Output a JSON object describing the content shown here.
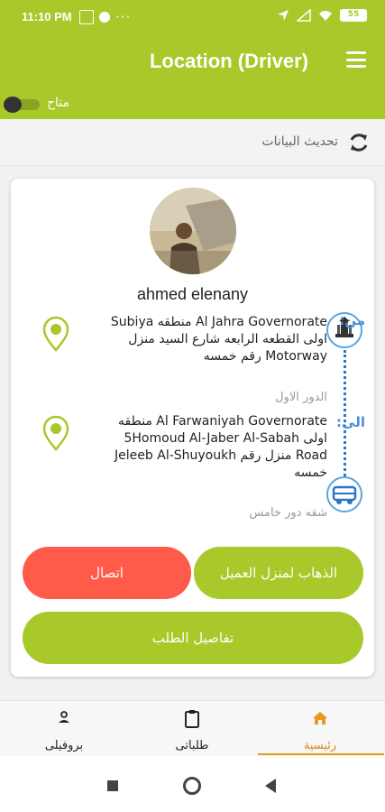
{
  "status_bar": {
    "time": "11:10 PM",
    "battery": "55"
  },
  "app_bar": {
    "title": "Location (Driver)"
  },
  "availability": {
    "label": "متاح",
    "enabled": false
  },
  "refresh": {
    "label": "تحديث البيانات"
  },
  "customer": {
    "name": "ahmed elenany"
  },
  "route": {
    "from_label": "من:",
    "from_address": "Al Jahra Governorate منطقه Subiya اولى القطعه الرابعه شارع السيد منزل Motorway رقم خمسه",
    "from_floor": "الدور الاول",
    "to_label": "الى:",
    "to_address": "Al Farwaniyah Governorate منطقه اولى 5Homoud Al-Jaber Al-Sabah Road منزل رقم Jeleeb Al-Shuyoukh خمسه",
    "to_floor": "شقه دور خامس"
  },
  "actions": {
    "go_to_customer": "الذهاب لمنزل العميل",
    "call": "اتصال",
    "order_details": "تفاصيل الطلب"
  },
  "bottom_nav": {
    "home": "رئيسية",
    "orders": "طلباتى",
    "profile": "بروفيلى"
  },
  "colors": {
    "primary": "#a9c82a",
    "danger": "#ff5a4a",
    "route_blue": "#4a90d9",
    "active_tab": "#e59a1a"
  }
}
